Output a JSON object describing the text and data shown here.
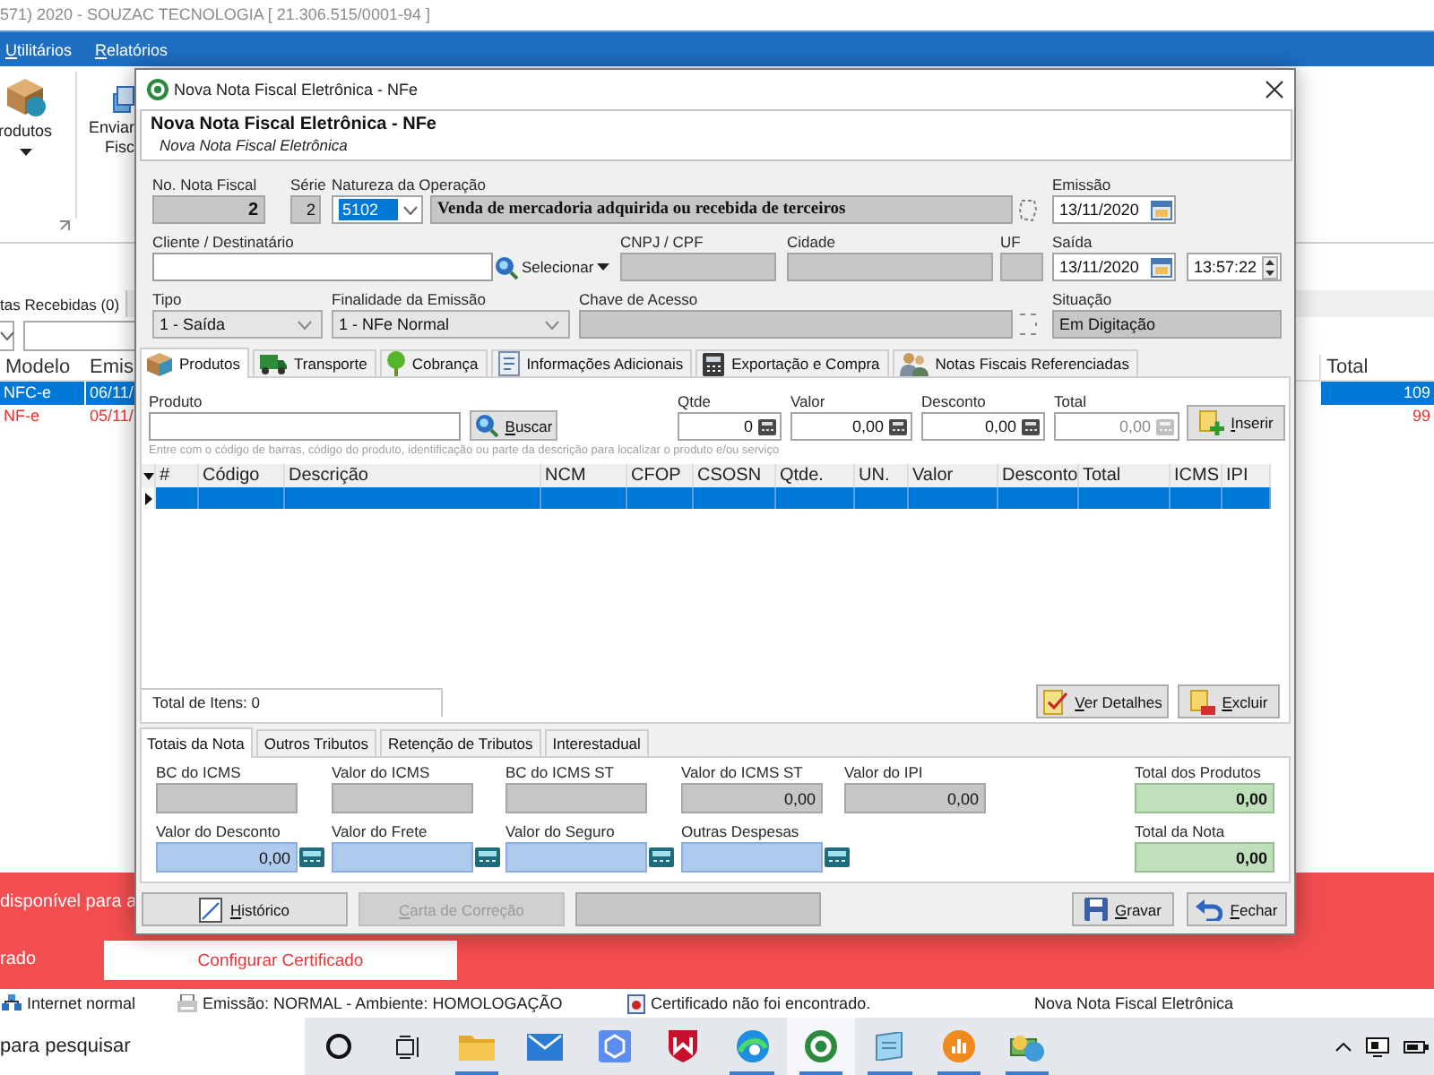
{
  "app": {
    "title": "571) 2020 - SOUZAC TECNOLOGIA [ 21.306.515/0001-94 ]",
    "menu": [
      "Utilitários",
      "Relatórios"
    ]
  },
  "ribbon": [
    {
      "lines": [
        "rodutos"
      ],
      "dropdown": true
    },
    {
      "lines": [
        "Enviar",
        "Fisc"
      ],
      "dropdown": false
    }
  ],
  "list": {
    "tab": "tas Recebidas (0)",
    "columns": [
      "Modelo",
      "Emis"
    ],
    "last_column": "Total",
    "rows": [
      {
        "cells": [
          "NFC-e",
          "06/11/"
        ],
        "total": "109",
        "selected": true
      },
      {
        "cells": [
          "NF-e",
          "05/11/"
        ],
        "total": "99",
        "selected": false,
        "color": "#e8322f"
      }
    ]
  },
  "dialog": {
    "title": "Nova Nota Fiscal Eletrônica - NFe",
    "heading": "Nova Nota Fiscal Eletrônica - NFe",
    "subheading": "Nova Nota Fiscal Eletrônica",
    "number": {
      "label": "No. Nota Fiscal",
      "value": "2",
      "disabled": true
    },
    "series": {
      "label": "Série",
      "value": "2",
      "disabled": true
    },
    "operation": {
      "label": "Natureza da Operação",
      "code": "5102",
      "highlighted": true,
      "description": "Venda de mercadoria adquirida ou recebida de terceiros"
    },
    "issue_date": {
      "label": "Emissão",
      "value": "13/11/2020"
    },
    "client": {
      "label": "Cliente / Destinatário",
      "button": "Selecionar"
    },
    "document": {
      "label": "CNPJ / CPF",
      "disabled": true
    },
    "city": {
      "label": "Cidade",
      "disabled": true
    },
    "state": {
      "label": "UF",
      "disabled": true
    },
    "departure": {
      "label": "Saída",
      "date": "13/11/2020",
      "time": "13:57:22"
    },
    "type": {
      "label": "Tipo",
      "value": "1 - Saída"
    },
    "purpose": {
      "label": "Finalidade da Emissão",
      "value": "1 - NFe Normal"
    },
    "access_key": {
      "label": "Chave de Acesso",
      "disabled": true
    },
    "situation": {
      "label": "Situação",
      "value": "Em Digitação",
      "disabled": true
    },
    "tabs": [
      {
        "label": "Produtos",
        "selected": true
      },
      {
        "label": "Transporte",
        "selected": false
      },
      {
        "label": "Cobrança",
        "selected": false
      },
      {
        "label": "Informações Adicionais",
        "selected": false
      },
      {
        "label": "Exportação e Compra",
        "selected": false
      },
      {
        "label": "Notas Fiscais Referenciadas",
        "selected": false
      }
    ],
    "product": {
      "label": "Produto",
      "button": "Buscar",
      "hint": "Entre com o código de barras, código do produto, identificação ou parte da descrição para localizar o produto e/ou serviço",
      "amounts": [
        {
          "label": "Qtde",
          "value": "0",
          "disabled": false
        },
        {
          "label": "Valor",
          "value": "0,00",
          "disabled": false
        },
        {
          "label": "Desconto",
          "value": "0,00",
          "disabled": false
        },
        {
          "label": "Total",
          "value": "0,00",
          "disabled": true
        }
      ],
      "insert_button": "Inserir"
    },
    "items": {
      "columns": [
        "#",
        "Código",
        "Descrição",
        "NCM",
        "CFOP",
        "CSOSN",
        "Qtde.",
        "UN.",
        "Valor",
        "Desconto",
        "Total",
        "ICMS",
        "IPI"
      ],
      "rows": [
        {
          "selected": true
        }
      ],
      "count": "Total de Itens: 0",
      "buttons": [
        "Ver Detalhes",
        "Excluir"
      ]
    },
    "totals_tabs": [
      {
        "label": "Totais da Nota",
        "selected": true
      },
      {
        "label": "Outros Tributos",
        "selected": false
      },
      {
        "label": "Retenção de Tributos",
        "selected": false
      },
      {
        "label": "Interestadual",
        "selected": false
      }
    ],
    "totals": {
      "taxes": [
        {
          "label": "BC do ICMS",
          "disabled": true
        },
        {
          "label": "Valor do ICMS",
          "disabled": true
        },
        {
          "label": "BC do ICMS ST",
          "disabled": true
        },
        {
          "label": "Valor do ICMS ST",
          "value": "0,00",
          "disabled": true
        },
        {
          "label": "Valor do IPI",
          "value": "0,00",
          "disabled": true
        }
      ],
      "charges": [
        {
          "label": "Valor do Desconto",
          "value": "0,00",
          "disabled": false
        },
        {
          "label": "Valor do Frete",
          "disabled": false
        },
        {
          "label": "Valor do Seguro",
          "disabled": false
        },
        {
          "label": "Outras Despesas",
          "disabled": false
        }
      ],
      "products_total": {
        "label": "Total dos Produtos",
        "value": "0,00"
      },
      "invoice_total": {
        "label": "Total da Nota",
        "value": "0,00"
      }
    },
    "footer": {
      "history_button": "Histórico",
      "correction_button": {
        "label": "Carta de Correção",
        "disabled": true
      },
      "note_field": {
        "disabled": true
      },
      "save_button": "Gravar",
      "close_button": "Fechar"
    }
  },
  "banner": {
    "lines": [
      "disponível para a",
      "rado"
    ],
    "button": "Configurar Certificado"
  },
  "status_bar": [
    "Internet normal",
    "Emissão: NORMAL - Ambiente: HOMOLOGAÇÃO",
    "Certificado não foi encontrado.",
    "Nova Nota Fiscal Eletrônica"
  ],
  "taskbar": {
    "search": {
      "placeholder": "para pesquisar"
    },
    "apps": [
      {
        "running": true,
        "selected": false
      },
      {
        "running": false,
        "selected": false
      },
      {
        "running": false,
        "selected": false
      },
      {
        "running": false,
        "selected": false
      },
      {
        "running": true,
        "selected": false
      },
      {
        "running": true,
        "selected": true
      },
      {
        "running": true,
        "selected": false
      },
      {
        "running": true,
        "selected": false
      },
      {
        "running": true,
        "selected": false
      }
    ]
  }
}
